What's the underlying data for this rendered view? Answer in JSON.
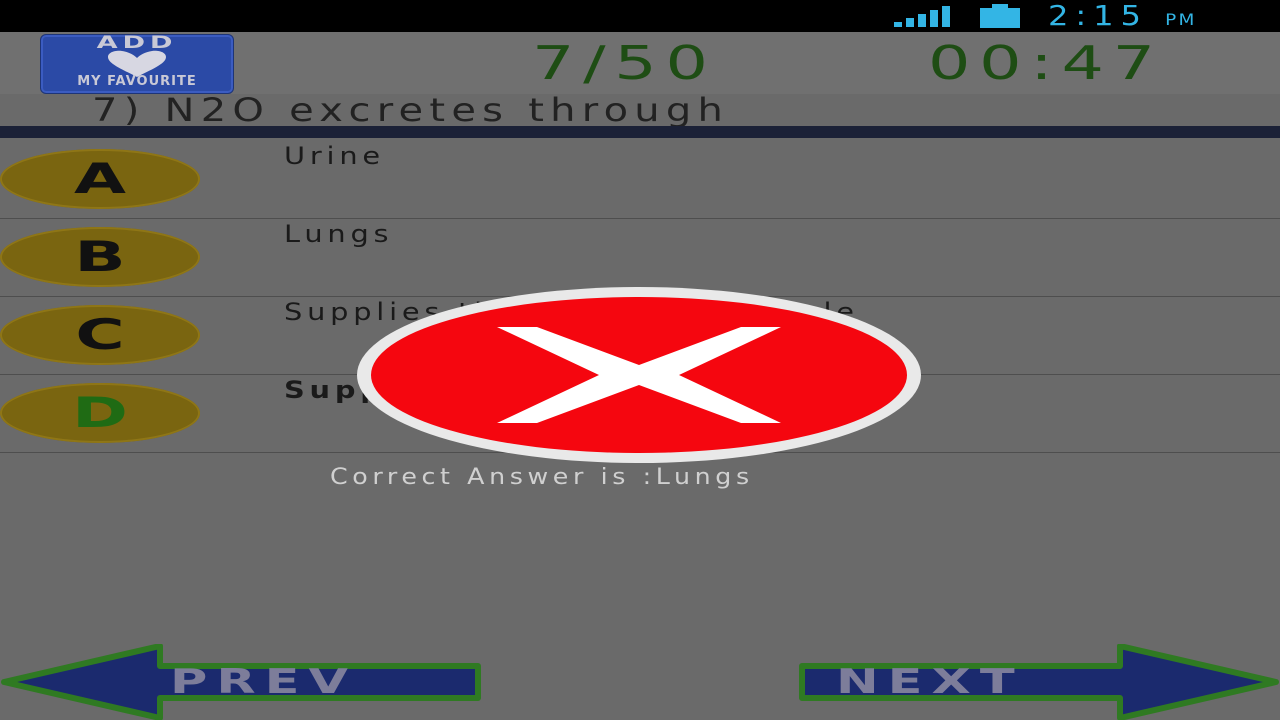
{
  "status_bar": {
    "time": "2:15",
    "ampm": "PM",
    "signal_icon": "signal-bars-icon",
    "battery_icon": "battery-icon"
  },
  "header": {
    "favourite_button": {
      "line1": "ADD",
      "line2": "MY FAVOURITE",
      "icon": "heart-icon"
    },
    "progress": "7/50",
    "timer": "00:47"
  },
  "question": {
    "text": "7) N2O excretes through"
  },
  "options": [
    {
      "letter": "A",
      "text": "Urine"
    },
    {
      "letter": "B",
      "text": "Lungs"
    },
    {
      "letter": "C",
      "text": "Supplies the supinator muscle"
    },
    {
      "letter": "D",
      "text": "Supplies the supinator"
    }
  ],
  "result": {
    "icon": "wrong-answer-x-icon",
    "message": "Correct Answer is :Lungs"
  },
  "navigation": {
    "prev_label": "PREV",
    "next_label": "NEXT"
  },
  "colors": {
    "accent_blue": "#2b4aa6",
    "timer_green": "#1e4d14",
    "wrong_red": "#f5060f",
    "badge_gold": "#7a6510",
    "correct_letter_green": "#1f6b14"
  }
}
